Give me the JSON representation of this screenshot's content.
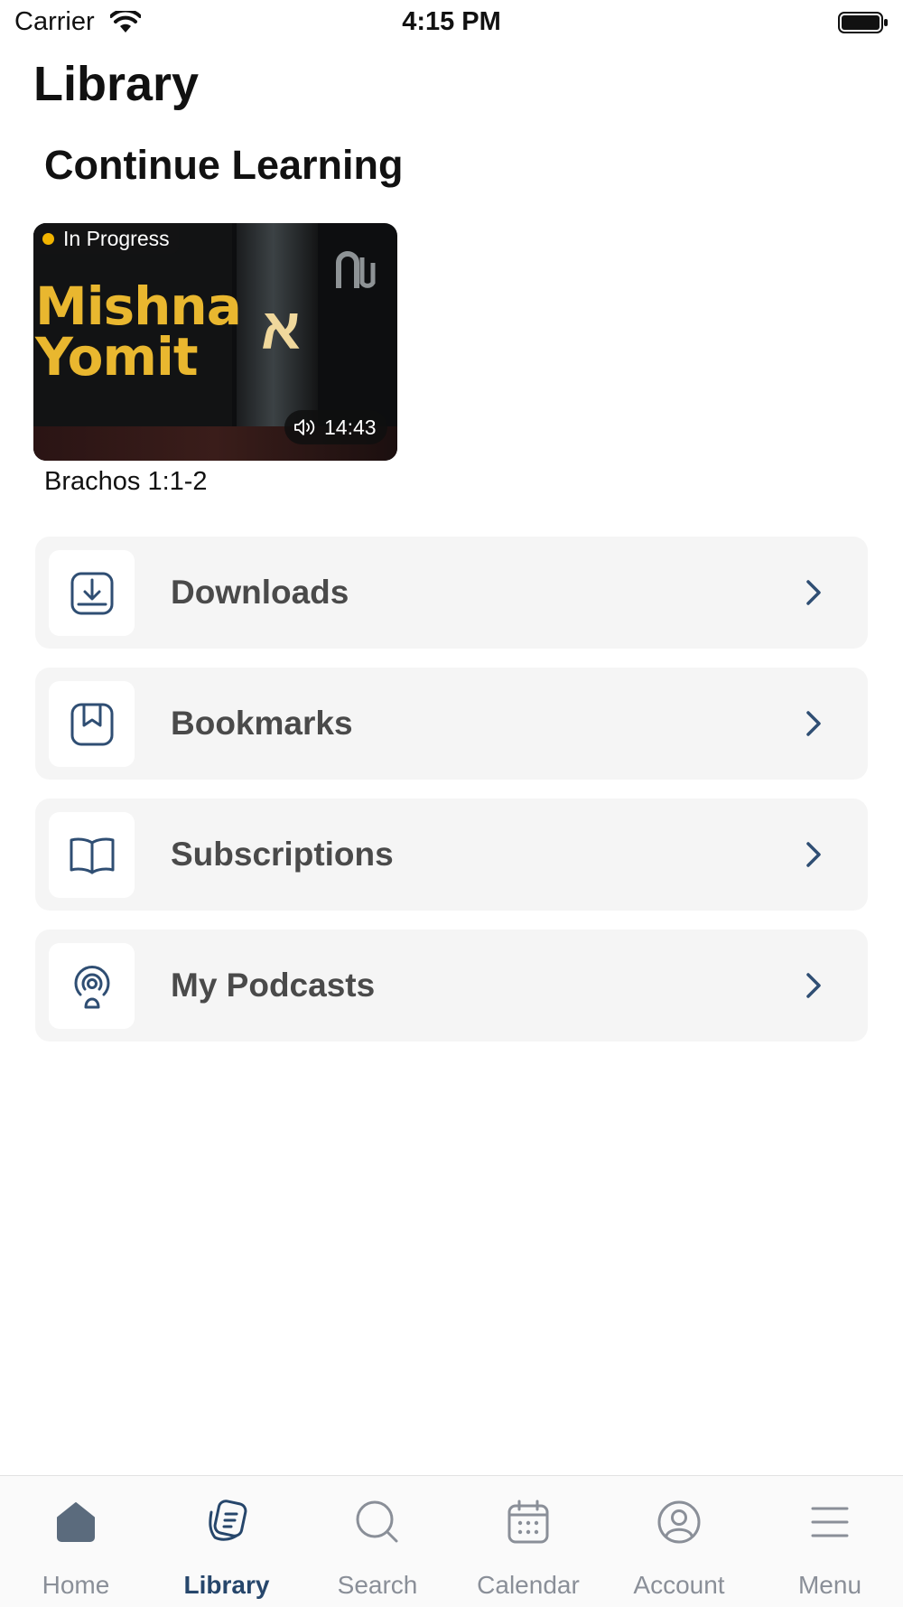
{
  "status_bar": {
    "carrier": "Carrier",
    "time": "4:15 PM"
  },
  "page_title": "Library",
  "continue_section": {
    "title": "Continue Learning",
    "item": {
      "status": "In Progress",
      "cover_title_line1": "Mishna",
      "cover_title_line2": "Yomit",
      "cover_letter": "א",
      "duration": "14:43",
      "caption": "Brachos 1:1-2"
    }
  },
  "library_items": [
    {
      "label": "Downloads",
      "icon": "download-icon"
    },
    {
      "label": "Bookmarks",
      "icon": "bookmark-icon"
    },
    {
      "label": "Subscriptions",
      "icon": "book-open-icon"
    },
    {
      "label": "My Podcasts",
      "icon": "podcast-icon"
    }
  ],
  "tabs": [
    {
      "label": "Home",
      "icon": "home-icon",
      "active": false
    },
    {
      "label": "Library",
      "icon": "library-icon",
      "active": true
    },
    {
      "label": "Search",
      "icon": "search-icon",
      "active": false
    },
    {
      "label": "Calendar",
      "icon": "calendar-icon",
      "active": false
    },
    {
      "label": "Account",
      "icon": "account-icon",
      "active": false
    },
    {
      "label": "Menu",
      "icon": "menu-icon",
      "active": false
    }
  ],
  "colors": {
    "accent": "#26466b",
    "icon": "#2f4e73",
    "inactive_tab": "#8a8f98",
    "in_progress_dot": "#f2b400",
    "row_background": "#f5f5f5"
  }
}
